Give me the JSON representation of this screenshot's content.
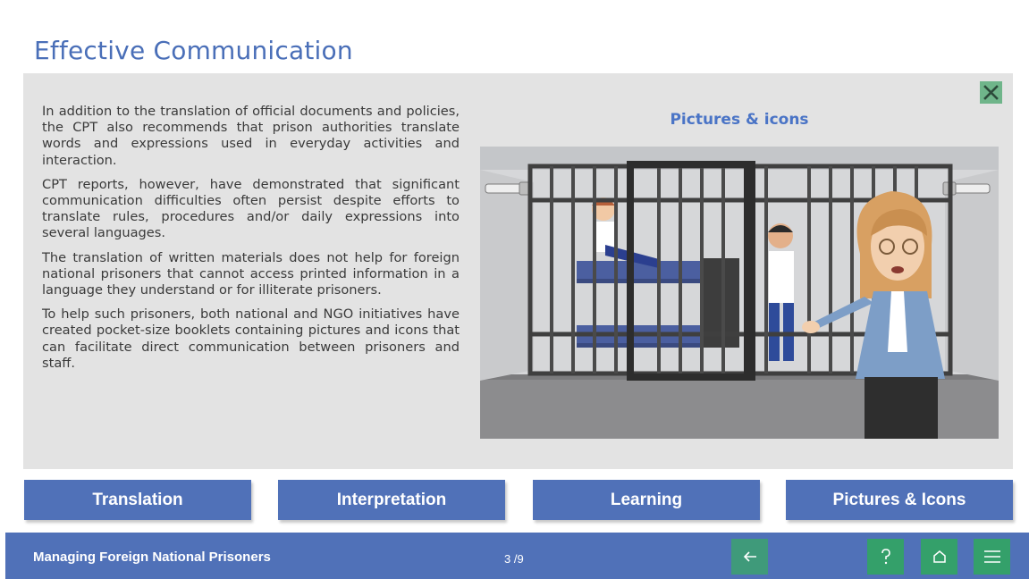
{
  "header": {
    "title": "Effective Communication"
  },
  "content": {
    "paragraphs": [
      "In addition to the translation of official documents and policies, the CPT also recommends that prison authorities translate words and expressions used in everyday activities and interaction.",
      "CPT reports, however, have demonstrated that significant communication difficulties often persist despite efforts to translate rules, procedures and/or daily expressions into several languages.",
      "The translation of written materials does not help for foreign national prisoners that cannot access printed information in a language they understand or for illiterate prisoners.",
      "To help such prisoners, both national and NGO initiatives have created pocket-size booklets containing pictures and icons that can facilitate direct communication between prisoners and staff."
    ],
    "image_title": "Pictures & icons",
    "close_icon": "close-icon"
  },
  "tabs": [
    {
      "label": "Translation"
    },
    {
      "label": "Interpretation"
    },
    {
      "label": "Learning"
    },
    {
      "label": "Pictures & Icons"
    }
  ],
  "footer": {
    "course_title": "Managing Foreign National Prisoners",
    "page_counter": "3 /9",
    "buttons": [
      {
        "icon": "arrow-left-icon"
      },
      {
        "icon": "question-icon"
      },
      {
        "icon": "home-icon"
      },
      {
        "icon": "menu-icon"
      }
    ]
  },
  "colors": {
    "accent_blue": "#5071b8",
    "title_blue": "#4a6fb8",
    "button_green": "#34a06a",
    "panel_gray": "#e3e3e3"
  }
}
